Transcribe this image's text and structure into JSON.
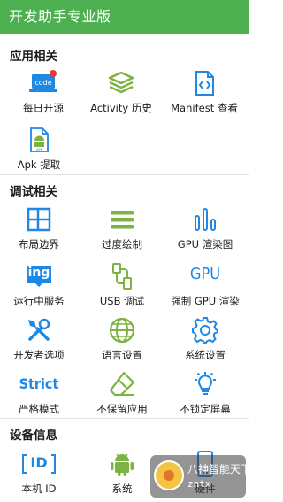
{
  "app": {
    "title": "开发助手专业版"
  },
  "sections": {
    "app": {
      "title": "应用相关"
    },
    "debug": {
      "title": "调试相关"
    },
    "device": {
      "title": "设备信息"
    }
  },
  "app_items": {
    "daily": {
      "label": "每日开源",
      "icon": "code-laptop-icon",
      "badge": "red-dot"
    },
    "activity": {
      "label": "Activity 历史",
      "icon": "layers-icon"
    },
    "manifest": {
      "label": "Manifest 查看",
      "icon": "file-code-icon"
    },
    "apk": {
      "label": "Apk 提取",
      "icon": "apk-file-icon"
    }
  },
  "debug_items": {
    "layout": {
      "label": "布局边界",
      "icon": "layout-grid-icon"
    },
    "overdraw": {
      "label": "过度绘制",
      "icon": "overdraw-bars-icon"
    },
    "gpu_render": {
      "label": "GPU 渲染图",
      "icon": "gpu-bars-icon"
    },
    "running": {
      "label": "运行中服务",
      "icon": "running-service-icon",
      "icon_text": "ing"
    },
    "usb": {
      "label": "USB 调试",
      "icon": "usb-icon"
    },
    "force_gpu": {
      "label": "强制 GPU 渲染",
      "icon": "gpu-text-icon",
      "icon_text": "GPU"
    },
    "dev_options": {
      "label": "开发者选项",
      "icon": "tools-icon"
    },
    "language": {
      "label": "语言设置",
      "icon": "globe-icon"
    },
    "system": {
      "label": "系统设置",
      "icon": "gear-icon"
    },
    "strict": {
      "label": "严格模式",
      "icon": "strict-text-icon",
      "icon_text": "Strict"
    },
    "no_keep": {
      "label": "不保留应用",
      "icon": "eraser-icon"
    },
    "no_lock": {
      "label": "不锁定屏幕",
      "icon": "bulb-icon"
    }
  },
  "device_items": {
    "device_id": {
      "label": "本机 ID",
      "icon": "id-icon",
      "icon_text": "ID"
    },
    "system_info": {
      "label": "系统",
      "icon": "android-icon"
    },
    "hardware": {
      "label": "硬件",
      "icon": "phone-icon"
    }
  },
  "watermark": {
    "line1": "八神智能天下",
    "line2": "zntx"
  },
  "colors": {
    "appbar": "#4caf50",
    "icon_blue": "#1e88e5",
    "icon_green": "#7cb342",
    "badge_red": "#e53935"
  }
}
